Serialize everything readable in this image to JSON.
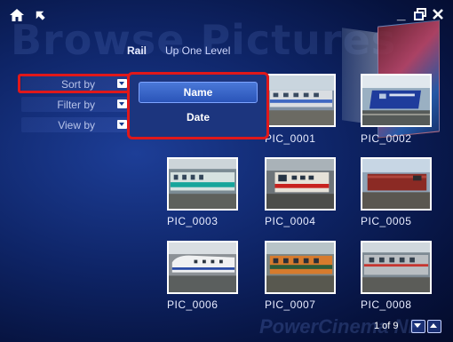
{
  "watermark": "Browse Pictures",
  "watermark_bottom": "PowerCinema NE",
  "top_icons": [
    "home-icon",
    "back-icon"
  ],
  "window_controls": [
    "minimize-icon",
    "restore-icon",
    "close-icon"
  ],
  "breadcrumb": {
    "current": "Rail",
    "up": "Up One Level"
  },
  "side_menu": {
    "sort_by": "Sort by",
    "filter_by": "Filter by",
    "view_by": "View by"
  },
  "sort_dropdown": {
    "options": [
      "Name",
      "Date"
    ],
    "selected": "Name"
  },
  "highlight_color": "#e0181a",
  "photos": [
    {
      "caption": "PIC_0001"
    },
    {
      "caption": "PIC_0002"
    },
    {
      "caption": "PIC_0003"
    },
    {
      "caption": "PIC_0004"
    },
    {
      "caption": "PIC_0005"
    },
    {
      "caption": "PIC_0006"
    },
    {
      "caption": "PIC_0007"
    },
    {
      "caption": "PIC_0008"
    }
  ],
  "pagination": {
    "text": "1 of 9"
  }
}
